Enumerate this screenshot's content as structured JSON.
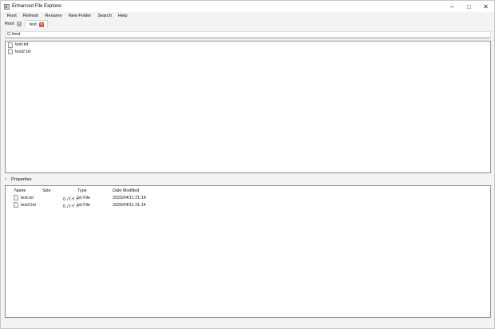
{
  "window": {
    "title": "Enhanced File Explorer"
  },
  "menu": [
    "Root",
    "Refresh",
    "Rename",
    "New Folder",
    "Search",
    "Help"
  ],
  "tabs": [
    {
      "label": "Root",
      "active": false
    },
    {
      "label": "test",
      "active": true
    }
  ],
  "path": {
    "value": "C:/test"
  },
  "files": [
    {
      "name": "test.txt"
    },
    {
      "name": "test2.txt"
    }
  ],
  "properties": {
    "label": "Properties",
    "columns": [
      "Name",
      "Size",
      "Type",
      "Date Modified"
    ],
    "rows": [
      {
        "name": "test.txt",
        "size": "0 バイト",
        "type": "txt File",
        "date": "2025/04/11 21:14"
      },
      {
        "name": "test2.txt",
        "size": "0 バイト",
        "type": "txt File",
        "date": "2025/04/11 21:14"
      }
    ]
  },
  "colors": {
    "active_tab_close": "#e05a3a",
    "inactive_tab_close": "#a8a8a8"
  }
}
